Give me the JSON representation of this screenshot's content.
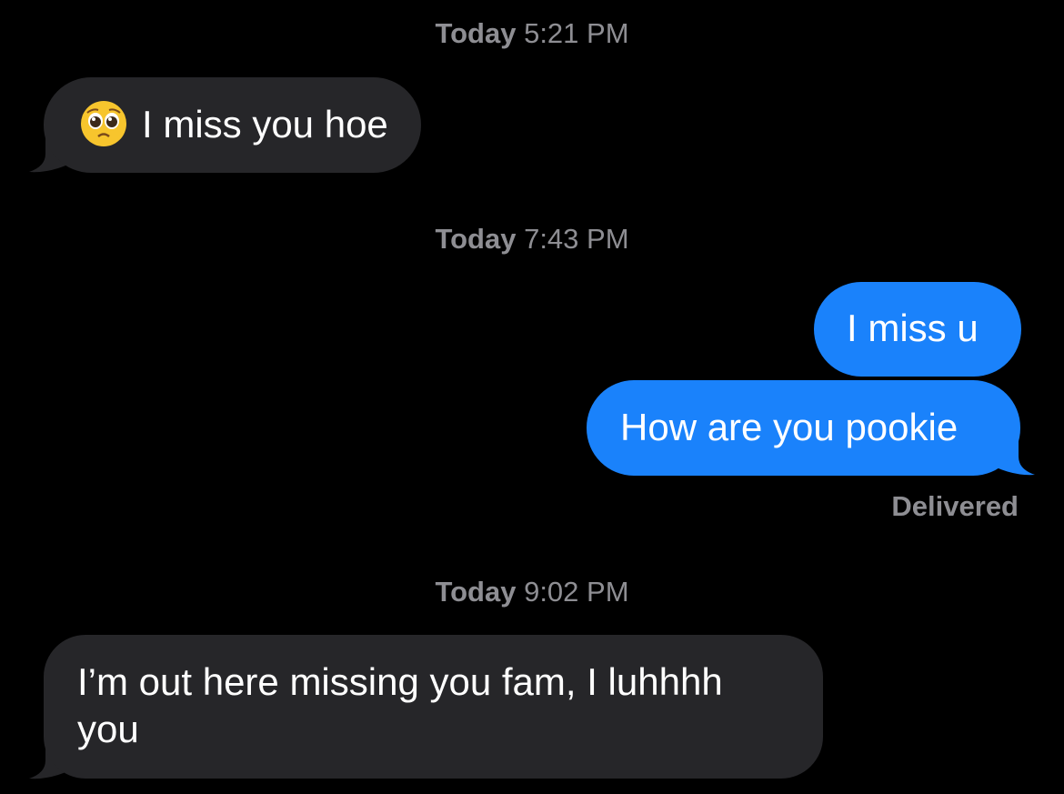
{
  "conversation": {
    "groups": [
      {
        "timestamp_day": "Today",
        "timestamp_time": "5:21 PM",
        "messages": [
          {
            "direction": "incoming",
            "emoji": "pleading-face",
            "text": "I miss you hoe"
          }
        ]
      },
      {
        "timestamp_day": "Today",
        "timestamp_time": "7:43 PM",
        "messages": [
          {
            "direction": "outgoing",
            "text": "I miss u"
          },
          {
            "direction": "outgoing",
            "text": "How are you pookie"
          }
        ],
        "status": "Delivered"
      },
      {
        "timestamp_day": "Today",
        "timestamp_time": "9:02 PM",
        "messages": [
          {
            "direction": "incoming",
            "text": "I’m out here missing you fam, I luhhhh you"
          }
        ]
      }
    ]
  },
  "colors": {
    "background": "#000000",
    "incoming_bubble": "#262629",
    "outgoing_bubble": "#1a82fb",
    "timestamp_text": "#8e8e93",
    "message_text": "#ffffff"
  }
}
